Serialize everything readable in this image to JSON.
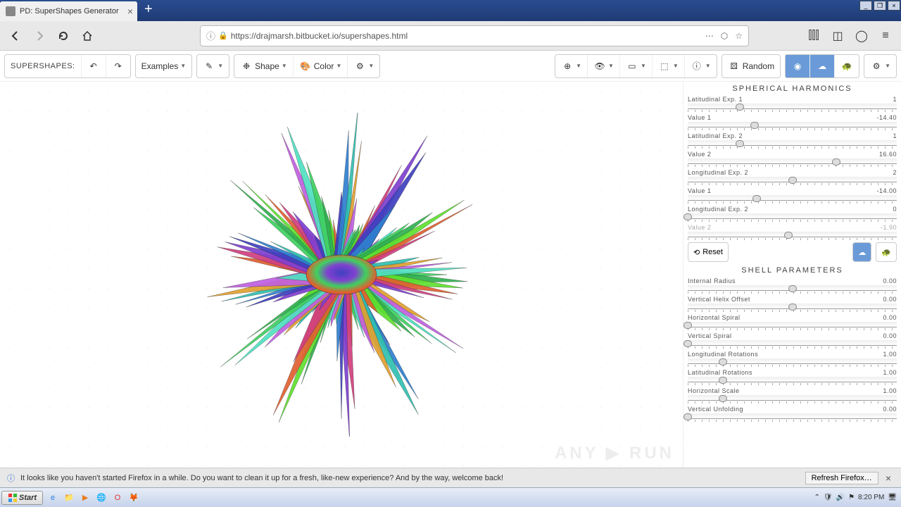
{
  "browser": {
    "tab_title": "PD: SuperShapes Generator",
    "url": "https://drajmarsh.bitbucket.io/supershapes.html"
  },
  "toolbar": {
    "app_label": "SUPERSHAPES:",
    "examples": "Examples",
    "shape": "Shape",
    "color": "Color",
    "random": "Random"
  },
  "panel1": {
    "title": "SPHERICAL HARMONICS",
    "reset": "Reset",
    "sliders": [
      {
        "label": "Latitudinal Exp. 1",
        "value": "1",
        "pos": 25
      },
      {
        "label": "Value 1",
        "value": "-14.40",
        "pos": 32
      },
      {
        "label": "Latitudinal Exp. 2",
        "value": "1",
        "pos": 25
      },
      {
        "label": "Value 2",
        "value": "16.60",
        "pos": 71
      },
      {
        "label": "Longitudinal Exp. 2",
        "value": "2",
        "pos": 50
      },
      {
        "label": "Value 1",
        "value": "-14.00",
        "pos": 33
      },
      {
        "label": "Longitudinal Exp. 2",
        "value": "0",
        "pos": 0
      },
      {
        "label": "Value 2",
        "value": "-1.90",
        "pos": 48,
        "disabled": true
      }
    ]
  },
  "panel2": {
    "title": "SHELL PARAMETERS",
    "sliders": [
      {
        "label": "Internal Radius",
        "value": "0.00",
        "pos": 50
      },
      {
        "label": "Vertical Helix Offset",
        "value": "0.00",
        "pos": 50
      },
      {
        "label": "Horizontal Spiral",
        "value": "0.00",
        "pos": 0
      },
      {
        "label": "Vertical Spiral",
        "value": "0.00",
        "pos": 0
      },
      {
        "label": "Longitudinal Rotations",
        "value": "1.00",
        "pos": 17
      },
      {
        "label": "Latitudinal Rotations",
        "value": "1.00",
        "pos": 17
      },
      {
        "label": "Horizontal Scale",
        "value": "1.00",
        "pos": 17
      },
      {
        "label": "Vertical Unfolding",
        "value": "0.00",
        "pos": 0
      }
    ]
  },
  "notification": {
    "text": "It looks like you haven't started Firefox in a while. Do you want to clean it up for a fresh, like-new experience? And by the way, welcome back!",
    "button": "Refresh Firefox…"
  },
  "taskbar": {
    "start": "Start",
    "time": "8:20 PM"
  },
  "watermark": "ANY ▶ RUN"
}
